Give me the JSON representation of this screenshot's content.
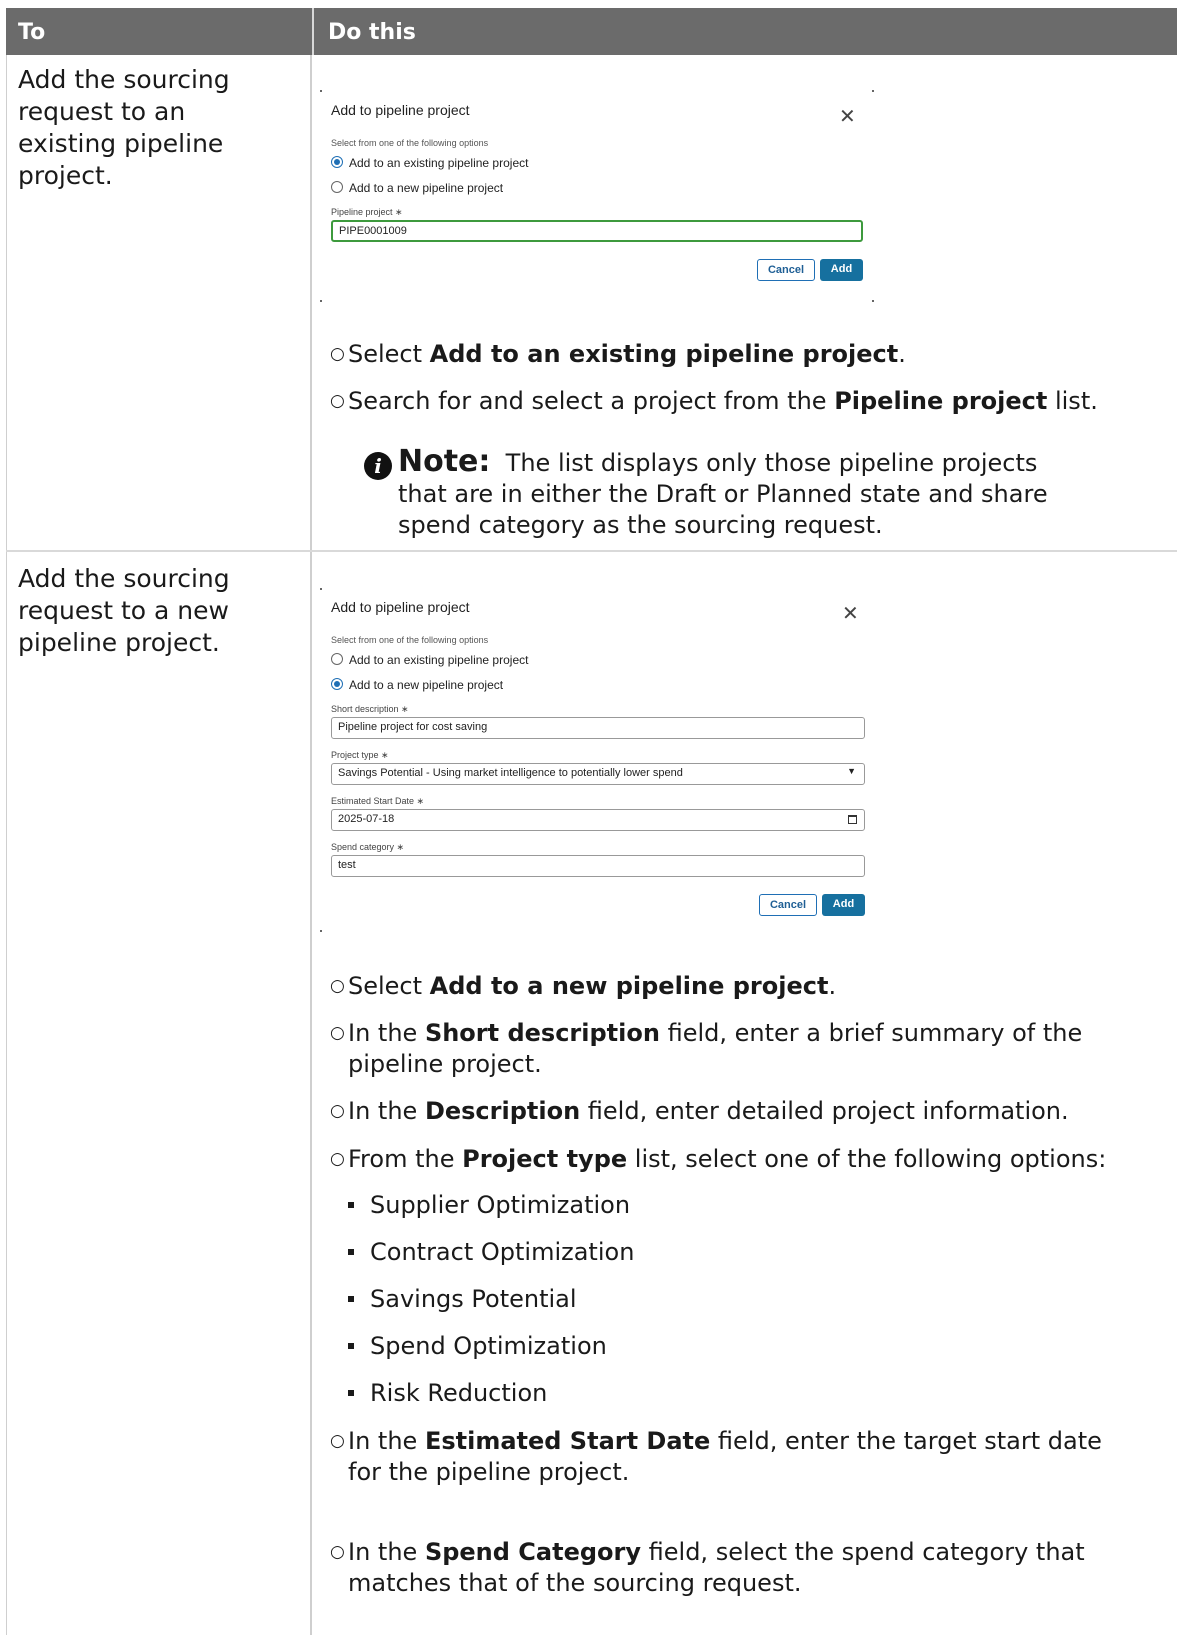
{
  "header": {
    "col1": "To",
    "col2": "Do this"
  },
  "row1": {
    "to": "Add the sourcing request to an existing pipeline project.",
    "dialog": {
      "title": "Add to pipeline project",
      "subtitle": "Select from one of the following options",
      "option1": "Add to an existing pipeline project",
      "option2": "Add to a new pipeline project",
      "field_label": "Pipeline project ∗",
      "field_value": "PIPE0001009",
      "cancel": "Cancel",
      "add": "Add"
    },
    "steps": [
      {
        "pre": "Select ",
        "bold": "Add to an existing pipeline project",
        "post": "."
      },
      {
        "pre": "Search for and select a project from the ",
        "bold": "Pipeline project",
        "post": " list."
      }
    ],
    "note_label": "Note:",
    "note_text": "The list displays only those pipeline projects that are in either the Draft or Planned state and share spend category as the sourcing request."
  },
  "row2": {
    "to": "Add the sourcing request to a new pipeline project.",
    "dialog": {
      "title": "Add to pipeline project",
      "subtitle": "Select from one of the following options",
      "option1": "Add to an existing pipeline project",
      "option2": "Add to a new pipeline project",
      "short_desc_label": "Short description ∗",
      "short_desc_value": "Pipeline project for cost saving",
      "project_type_label": "Project type ∗",
      "project_type_value": "Savings Potential - Using market intelligence to potentially lower spend",
      "start_date_label": "Estimated Start Date ∗",
      "start_date_value": "2025-07-18",
      "spend_label": "Spend category ∗",
      "spend_value": "test",
      "cancel": "Cancel",
      "add": "Add"
    },
    "steps": [
      {
        "pre": "Select ",
        "bold": "Add to a new pipeline project",
        "post": "."
      },
      {
        "pre": "In the ",
        "bold": "Short description",
        "post": " field, enter a brief summary of the pipeline project."
      },
      {
        "pre": "In the ",
        "bold": "Description",
        "post": " field, enter detailed project information."
      },
      {
        "pre": "From the ",
        "bold": "Project type",
        "post": " list, select one of the following options:"
      },
      {
        "pre": "In the ",
        "bold": "Estimated Start Date",
        "post": " field, enter the target start date for the pipeline project."
      },
      {
        "pre": "In the ",
        "bold": "Spend Category",
        "post": " field, select the spend category that matches that of the sourcing request."
      }
    ],
    "options": [
      "Supplier Optimization",
      "Contract Optimization",
      "Savings Potential",
      "Spend Optimization",
      "Risk Reduction"
    ]
  }
}
